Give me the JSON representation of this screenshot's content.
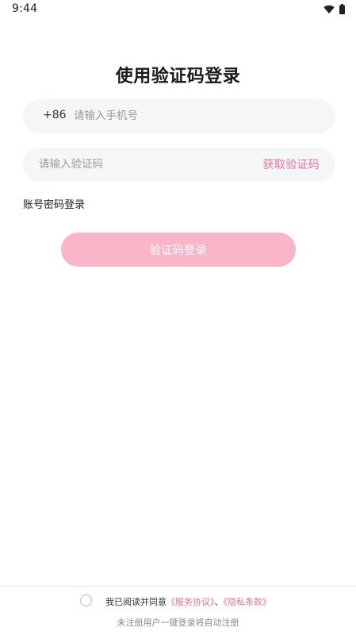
{
  "status_bar": {
    "time": "9:44",
    "icons": [
      "wifi-icon",
      "battery-icon"
    ]
  },
  "title": "使用验证码登录",
  "phone": {
    "country_code": "+86",
    "value": "",
    "placeholder": "请输入手机号"
  },
  "code": {
    "value": "",
    "placeholder": "请输入验证码",
    "get_code_label": "获取验证码"
  },
  "password_login_label": "账号密码登录",
  "login_button_label": "验证码登录",
  "agreement": {
    "checked": false,
    "prefix": "我已阅读并同意",
    "service_link": "《服务协议》",
    "separator": "、",
    "privacy_link": "《隐私条款》"
  },
  "register_note": "未注册用户一键登录将自动注册",
  "colors": {
    "accent": "#ee6f97",
    "button_disabled": "#f9b6c8",
    "field_bg": "#f5f6f8"
  }
}
